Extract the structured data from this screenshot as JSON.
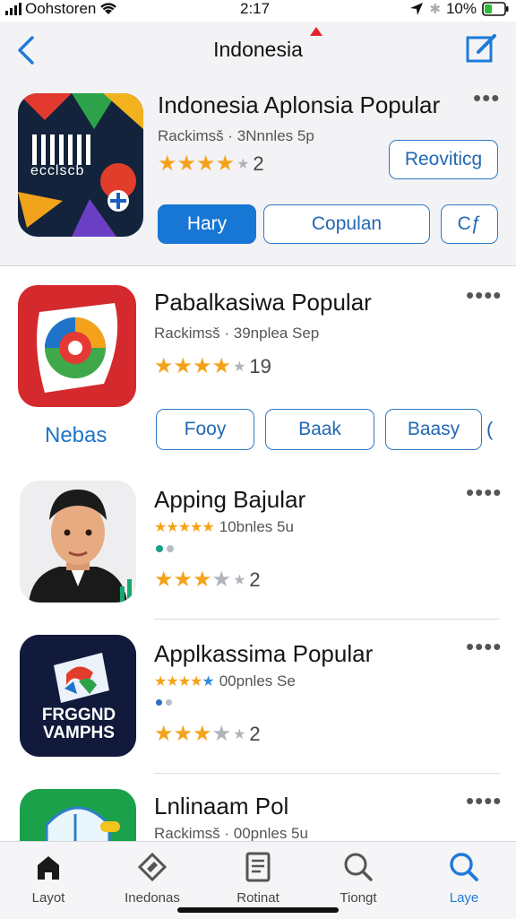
{
  "status_bar": {
    "carrier": "Oohstoren",
    "time": "2:17",
    "battery": "10%"
  },
  "nav": {
    "title": "Indonesia"
  },
  "featured": {
    "name": "Indonesia Aplonsia Popular",
    "subtitle": "Rackimsš · 3Nnnles 5p",
    "icon_caption": "ecclscb",
    "stars_filled": 4,
    "rating_count": "2",
    "side_button": "Reoviticɡ",
    "buttons": [
      "Hary",
      "Copulan",
      "Cƒ"
    ]
  },
  "apps": [
    {
      "name": "Pabalkasiwa Popular",
      "subtitle": "Rackimsš · 39nplea Sep",
      "stars_filled": 4,
      "rating_count": "19",
      "icon_caption": "Nebas",
      "buttons": [
        "Fooy",
        "Baak",
        "Baasy"
      ]
    },
    {
      "name": "Apping Bajular",
      "subtitle": "10bnles 5u",
      "stars_filled": 3,
      "rating_count": "2"
    },
    {
      "name": "Applkassima Popular",
      "subtitle": "00pnles Se",
      "stars_filled": 3,
      "rating_count": "2",
      "icon_text": "FRGGND VAMPHS"
    },
    {
      "name": "Lnlinaam Pol",
      "subtitle": "Rackimsš · 00pnles 5u"
    }
  ],
  "tabs": [
    {
      "label": "Layot",
      "icon": "home-icon",
      "active": false
    },
    {
      "label": "Inedonas",
      "icon": "apps-icon",
      "active": false
    },
    {
      "label": "Rotinat",
      "icon": "list-icon",
      "active": false
    },
    {
      "label": "Tiongt",
      "icon": "search-icon",
      "active": false
    },
    {
      "label": "Laye",
      "icon": "search-icon",
      "active": true
    }
  ],
  "colors": {
    "accent": "#1877d4",
    "star": "#f5a21b",
    "nav_bg": "#f3f3f6"
  }
}
